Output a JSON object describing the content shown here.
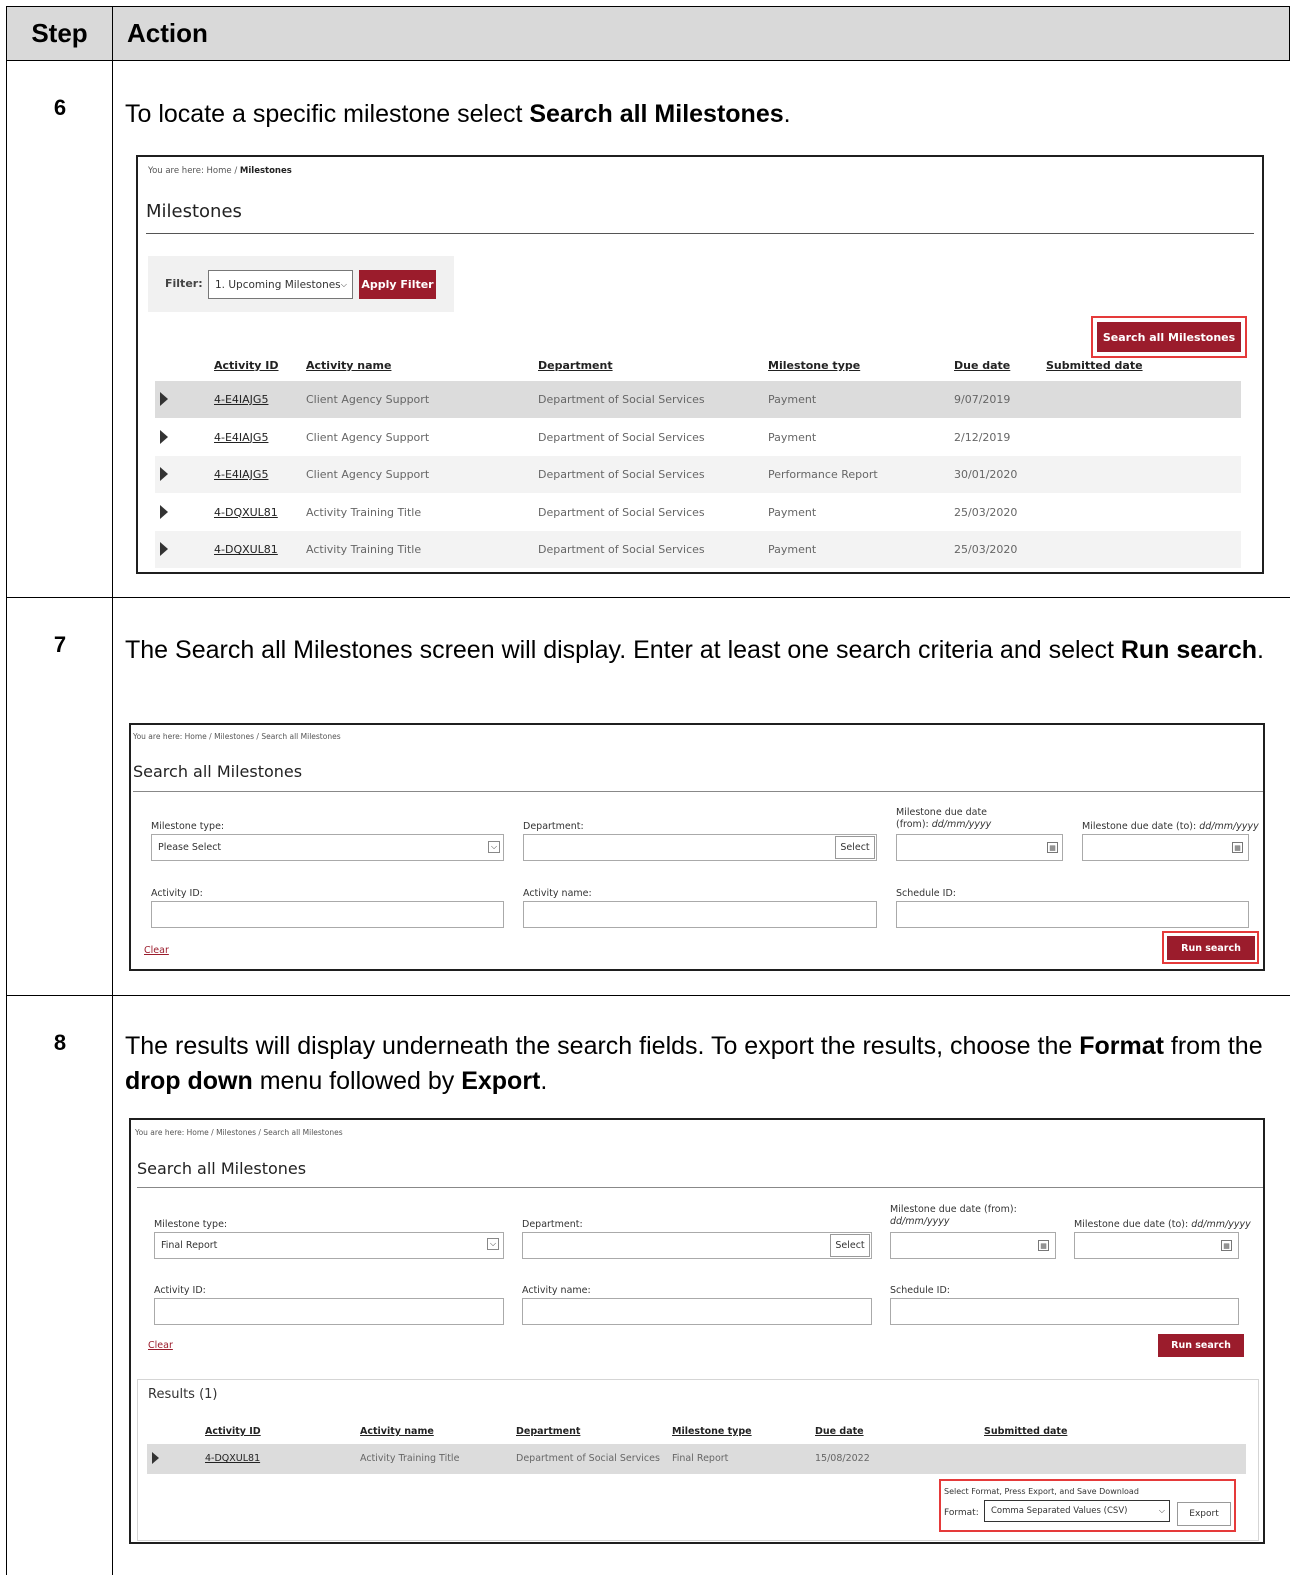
{
  "header": {
    "step": "Step",
    "action": "Action"
  },
  "step6": {
    "num": "6",
    "t1": "To locate a specific milestone select ",
    "b1": "Search all Milestones",
    "t2": ".",
    "shot": {
      "bc_prefix": "You are here:  Home  /",
      "bc_current": "Milestones",
      "title": "Milestones",
      "filter_label": "Filter:",
      "filter_value": "1. Upcoming Milestones",
      "apply": "Apply Filter",
      "search_all": "Search all Milestones",
      "cols": [
        "Activity ID",
        "Activity name",
        "Department",
        "Milestone type",
        "Due date",
        "Submitted date"
      ],
      "rows": [
        [
          "4-E4IAJG5",
          "Client Agency Support",
          "Department of Social Services",
          "Payment",
          "9/07/2019"
        ],
        [
          "4-E4IAJG5",
          "Client Agency Support",
          "Department of Social Services",
          "Payment",
          "2/12/2019"
        ],
        [
          "4-E4IAJG5",
          "Client Agency Support",
          "Department of Social Services",
          "Performance Report",
          "30/01/2020"
        ],
        [
          "4-DQXUL81",
          "Activity Training Title",
          "Department of Social Services",
          "Payment",
          "25/03/2020"
        ],
        [
          "4-DQXUL81",
          "Activity Training Title",
          "Department of Social Services",
          "Payment",
          "25/03/2020"
        ]
      ]
    }
  },
  "step7": {
    "num": "7",
    "t1": "The Search all Milestones screen will display. Enter at least one search criteria and select ",
    "b1": "Run search",
    "t2": ".",
    "shot": {
      "bc": "You are here:  Home  /  Milestones  /  Search all Milestones",
      "title": "Search all Milestones",
      "mt_label": "Milestone type:",
      "mt_value": "Please Select",
      "dept_label": "Department:",
      "select": "Select",
      "from_label1": "Milestone due date",
      "from_label2": "(from): ",
      "from_fmt": "dd/mm/yyyy",
      "to_label": "Milestone due date (to): ",
      "to_fmt": "dd/mm/yyyy",
      "aid_label": "Activity ID:",
      "aname_label": "Activity name:",
      "sid_label": "Schedule ID:",
      "clear": "Clear",
      "run": "Run search"
    }
  },
  "step8": {
    "num": "8",
    "t1": "The results will display underneath the search fields. To export the results, choose the ",
    "b1": "Format",
    "t2": " from the ",
    "b2": "drop down",
    "t3": " menu followed by ",
    "b3": "Export",
    "t4": ".",
    "shot": {
      "bc": "You are here:  Home  /  Milestones  /  Search all Milestones",
      "title": "Search all Milestones",
      "mt_label": "Milestone type:",
      "mt_value": "Final Report",
      "dept_label": "Department:",
      "select": "Select",
      "from_label1": "Milestone due date (from):",
      "from_fmt": "dd/mm/yyyy",
      "to_label": "Milestone due date (to): ",
      "to_fmt": "dd/mm/yyyy",
      "aid_label": "Activity ID:",
      "aname_label": "Activity name:",
      "sid_label": "Schedule ID:",
      "clear": "Clear",
      "run": "Run search",
      "results": "Results (1)",
      "cols": [
        "Activity ID",
        "Activity name",
        "Department",
        "Milestone type",
        "Due date",
        "Submitted date"
      ],
      "row": [
        "4-DQXUL81",
        "Activity Training Title",
        "Department of Social Services",
        "Final Report",
        "15/08/2022"
      ],
      "export_hint": "Select Format, Press Export, and Save Download",
      "format_label": "Format:",
      "format_value": "Comma Separated Values (CSV)",
      "export": "Export"
    }
  }
}
